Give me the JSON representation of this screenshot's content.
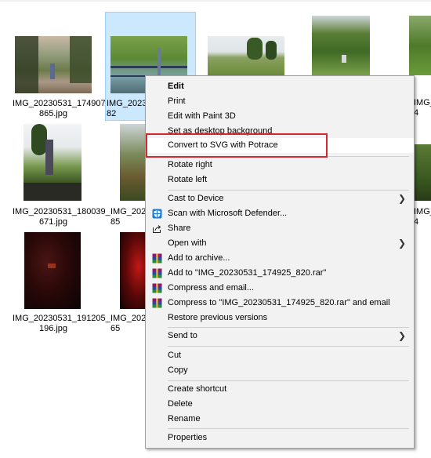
{
  "files": [
    {
      "name": "IMG_20230531_174907_\n865.jpg",
      "selected": false
    },
    {
      "name": "IMG_2023\n82",
      "selected": true
    },
    {
      "name": "",
      "selected": false
    },
    {
      "name": "",
      "selected": false
    },
    {
      "name": "IMG_20\n4",
      "selected": false
    },
    {
      "name": "IMG_20230531_180039_\n671.jpg",
      "selected": false
    },
    {
      "name": "IMG_2023\n85",
      "selected": false
    },
    {
      "name": "IMG_20\n4",
      "selected": false
    },
    {
      "name": "IMG_20230531_191205_\n196.jpg",
      "selected": false
    },
    {
      "name": "IMG_2023\n65",
      "selected": false
    }
  ],
  "context_menu": {
    "items": [
      {
        "label": "Edit",
        "bold": true
      },
      {
        "label": "Print"
      },
      {
        "label": "Edit with Paint 3D"
      },
      {
        "label": "Set as desktop background"
      },
      {
        "label": "Convert to SVG with Potrace",
        "highlighted": true
      },
      {
        "label": "Rotate right"
      },
      {
        "label": "Rotate left"
      },
      {
        "label": "Cast to Device",
        "submenu": true
      },
      {
        "label": "Scan with Microsoft Defender...",
        "icon": "defender-shield-icon"
      },
      {
        "label": "Share",
        "icon": "share-icon"
      },
      {
        "label": "Open with",
        "submenu": true
      },
      {
        "label": "Add to archive...",
        "icon": "winrar-icon"
      },
      {
        "label": "Add to \"IMG_20230531_174925_820.rar\"",
        "icon": "winrar-icon"
      },
      {
        "label": "Compress and email...",
        "icon": "winrar-icon"
      },
      {
        "label": "Compress to \"IMG_20230531_174925_820.rar\" and email",
        "icon": "winrar-icon"
      },
      {
        "label": "Restore previous versions"
      },
      {
        "label": "Send to",
        "submenu": true
      },
      {
        "label": "Cut"
      },
      {
        "label": "Copy"
      },
      {
        "label": "Create shortcut"
      },
      {
        "label": "Delete"
      },
      {
        "label": "Rename"
      },
      {
        "label": "Properties"
      }
    ]
  },
  "colors": {
    "selection_bg": "#cce8ff",
    "highlight_box": "#d8262e",
    "menu_bg": "#f2f2f2"
  }
}
